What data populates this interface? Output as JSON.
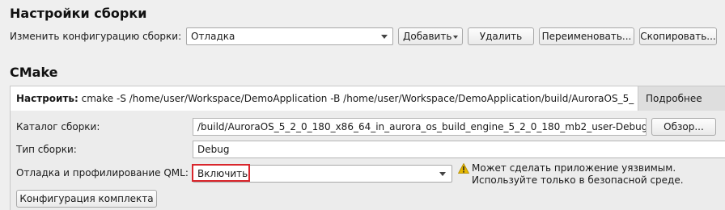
{
  "build_settings": {
    "title": "Настройки сборки",
    "edit_config_label": "Изменить конфигурацию сборки:",
    "config_value": "Отладка",
    "add_button": "Добавить",
    "delete_button": "Удалить",
    "rename_button": "Переименовать...",
    "clone_button": "Скопировать..."
  },
  "cmake": {
    "title": "CMake",
    "configure_label": "Настроить:",
    "configure_command": "cmake -S /home/user/Workspace/DemoApplication -B /home/user/Workspace/DemoApplication/build/AuroraOS_5_",
    "details_button": "Подробнее",
    "build_dir_label": "Каталог сборки:",
    "build_dir_value": "/build/AuroraOS_5_2_0_180_x86_64_in_aurora_os_build_engine_5_2_0_180_mb2_user-Debug",
    "browse_button": "Обзор...",
    "build_type_label": "Тип сборки:",
    "build_type_value": "Debug",
    "qml_debug_label": "Отладка и профилирование QML:",
    "qml_debug_value": "Включить",
    "warning_line1": "Может сделать приложение уязвимым.",
    "warning_line2": "Используйте только в безопасной среде.",
    "kit_config_button": "Конфигурация комплекта"
  },
  "icons": {
    "warning": "warning-icon",
    "dropdown": "chevron-down-icon"
  },
  "colors": {
    "highlight_border": "#d9262c",
    "warning_yellow": "#e6b800"
  }
}
